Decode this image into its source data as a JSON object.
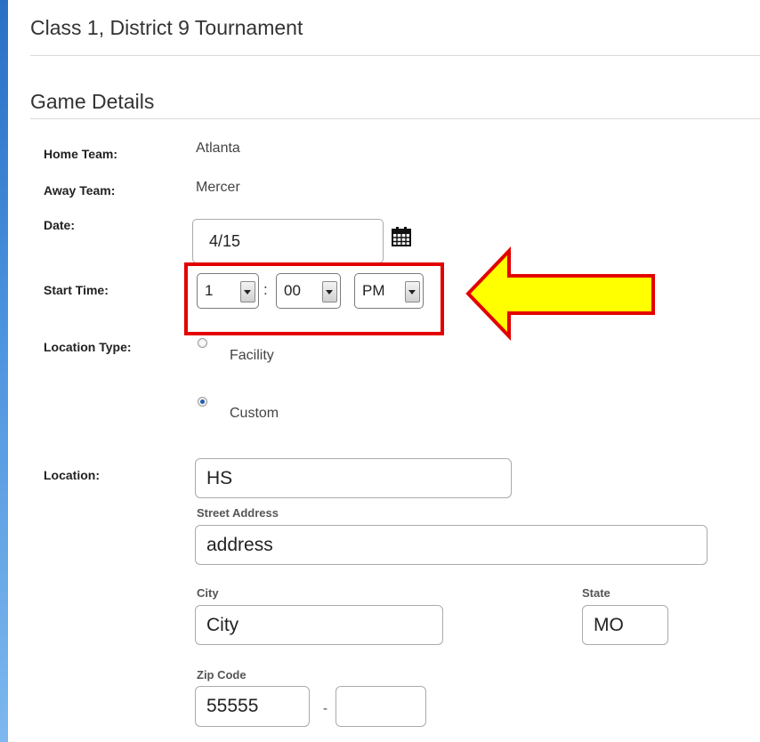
{
  "page": {
    "title": "Class 1, District 9 Tournament"
  },
  "section": {
    "title": "Game Details"
  },
  "fields": {
    "home_team": {
      "label": "Home Team:",
      "value": "Atlanta"
    },
    "away_team": {
      "label": "Away Team:",
      "value": "Mercer"
    },
    "date": {
      "label": "Date:",
      "value": "4/15",
      "icon": "calendar-icon"
    },
    "start_time": {
      "label": "Start Time:",
      "hour": "1",
      "minute": "00",
      "separator": ":",
      "ampm": "PM"
    },
    "location_type": {
      "label": "Location Type:",
      "options": [
        {
          "label": "Facility",
          "checked": false
        },
        {
          "label": "Custom",
          "checked": true
        }
      ]
    },
    "location": {
      "label": "Location:",
      "value": "HS"
    },
    "street_address": {
      "label": "Street Address",
      "value": "address"
    },
    "city": {
      "label": "City",
      "value": "City"
    },
    "state": {
      "label": "State",
      "value": "MO"
    },
    "zip": {
      "label": "Zip Code",
      "value": "55555",
      "separator": "-",
      "ext_value": ""
    }
  },
  "annotation": {
    "highlight_color": "#e30000",
    "arrow_fill": "#ffff00",
    "arrow_stroke": "#e30000"
  },
  "colors": {
    "accent": "#2a6fc4"
  }
}
